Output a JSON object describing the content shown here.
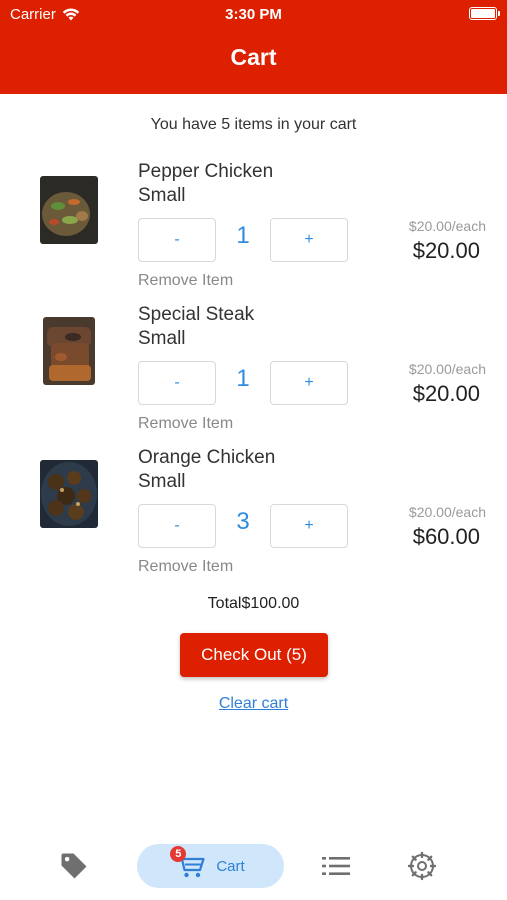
{
  "status_bar": {
    "carrier": "Carrier",
    "time": "3:30 PM"
  },
  "header": {
    "title": "Cart"
  },
  "summary": "You have 5 items in your cart",
  "items": [
    {
      "name": "Pepper Chicken",
      "size": "Small",
      "minus": "-",
      "quantity": "1",
      "plus": "+",
      "remove": "Remove Item",
      "unit_price": "$20.00/each",
      "line_total": "$20.00"
    },
    {
      "name": "Special Steak",
      "size": "Small",
      "minus": "-",
      "quantity": "1",
      "plus": "+",
      "remove": "Remove Item",
      "unit_price": "$20.00/each",
      "line_total": "$20.00"
    },
    {
      "name": "Orange Chicken",
      "size": "Small",
      "minus": "-",
      "quantity": "3",
      "plus": "+",
      "remove": "Remove Item",
      "unit_price": "$20.00/each",
      "line_total": "$60.00"
    }
  ],
  "total": "Total$100.00",
  "checkout_label": "Check Out (5)",
  "clear_label": "Clear cart",
  "tabbar": {
    "cart_label": "Cart",
    "cart_badge": "5",
    "icons": [
      "tag-icon",
      "cart-icon",
      "list-icon",
      "settings-icon"
    ]
  },
  "colors": {
    "header": "#dc2000",
    "accent": "#2f8de0",
    "active_tab_bg": "#cfe6fb",
    "badge": "#e53935"
  }
}
